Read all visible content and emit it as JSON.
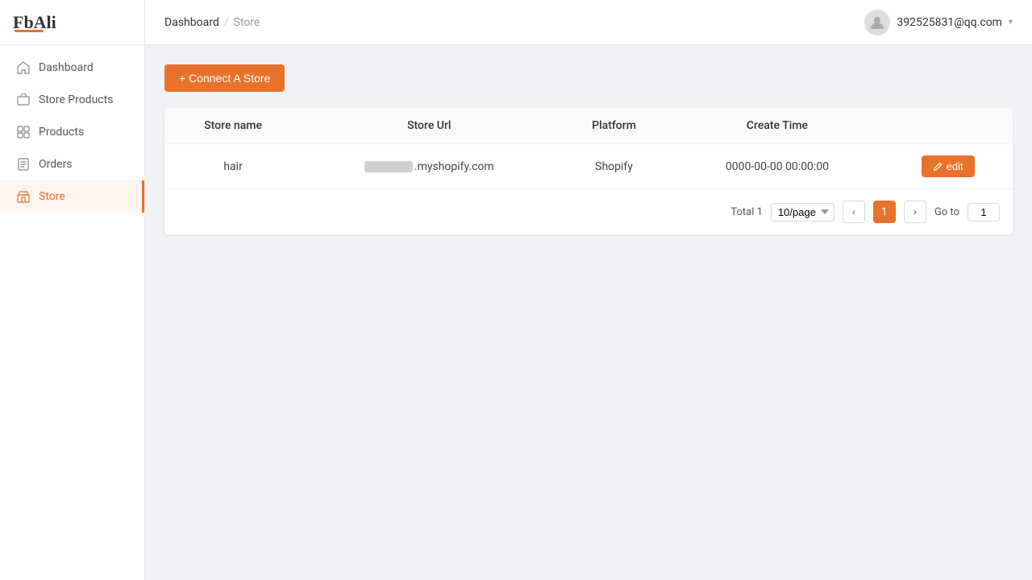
{
  "brand": {
    "name": "FbAli"
  },
  "header": {
    "breadcrumb": {
      "parent": "Dashboard",
      "separator": "/",
      "current": "Store"
    },
    "user": {
      "email": "392525831@qq.com",
      "chevron": "▾"
    }
  },
  "sidebar": {
    "items": [
      {
        "id": "dashboard",
        "label": "Dashboard",
        "active": false
      },
      {
        "id": "store-products",
        "label": "Store Products",
        "active": false
      },
      {
        "id": "products",
        "label": "Products",
        "active": false
      },
      {
        "id": "orders",
        "label": "Orders",
        "active": false
      },
      {
        "id": "store",
        "label": "Store",
        "active": true
      }
    ]
  },
  "toolbar": {
    "connect_label": "+ Connect A Store"
  },
  "table": {
    "columns": [
      "Store name",
      "Store Url",
      "Platform",
      "Create Time"
    ],
    "rows": [
      {
        "store_name": "hair",
        "store_url_suffix": ".myshopify.com",
        "platform": "Shopify",
        "create_time": "0000-00-00 00:00:00"
      }
    ],
    "edit_label": "edit"
  },
  "pagination": {
    "total_label": "Total",
    "total": 1,
    "per_page": "10/page",
    "current_page": 1,
    "goto_label": "Go to",
    "goto_value": "1"
  }
}
